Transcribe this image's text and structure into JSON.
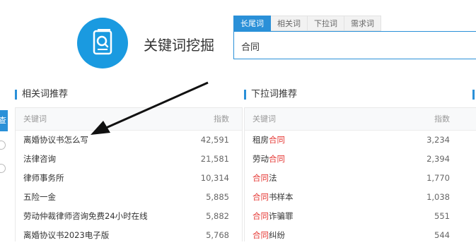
{
  "app": {
    "title": "关键词挖掘",
    "logo_icon": "magnifier-document-icon"
  },
  "search": {
    "tabs": [
      {
        "label": "长尾词",
        "active": true
      },
      {
        "label": "相关词",
        "active": false
      },
      {
        "label": "下拉词",
        "active": false
      },
      {
        "label": "需求词",
        "active": false
      }
    ],
    "value": "合同"
  },
  "sidebar": {
    "tab_label": "查"
  },
  "related": {
    "title": "相关词推荐",
    "columns": {
      "keyword": "关键词",
      "index": "指数"
    },
    "rows": [
      {
        "keyword": "离婚协议书怎么写",
        "index": "42,591"
      },
      {
        "keyword": "法律咨询",
        "index": "21,581"
      },
      {
        "keyword": "律师事务所",
        "index": "10,314"
      },
      {
        "keyword": "五险一金",
        "index": "5,885"
      },
      {
        "keyword": "劳动仲裁律师咨询免费24小时在线",
        "index": "5,882"
      },
      {
        "keyword": "离婚协议书2023电子版",
        "index": "5,768"
      }
    ]
  },
  "dropdown": {
    "title": "下拉词推荐",
    "columns": {
      "keyword": "关键词",
      "index": "指数"
    },
    "rows": [
      {
        "pre": "租房",
        "hl": "合同",
        "post": "",
        "index": "3,234"
      },
      {
        "pre": "劳动",
        "hl": "合同",
        "post": "",
        "index": "2,394"
      },
      {
        "pre": "",
        "hl": "合同",
        "post": "法",
        "index": "1,770"
      },
      {
        "pre": "",
        "hl": "合同",
        "post": "书样本",
        "index": "1,038"
      },
      {
        "pre": "",
        "hl": "合同",
        "post": "诈骗罪",
        "index": "551"
      },
      {
        "pre": "",
        "hl": "合同",
        "post": "纠纷",
        "index": "544"
      }
    ]
  },
  "colors": {
    "accent": "#2a90d8",
    "highlight": "#e53935"
  }
}
